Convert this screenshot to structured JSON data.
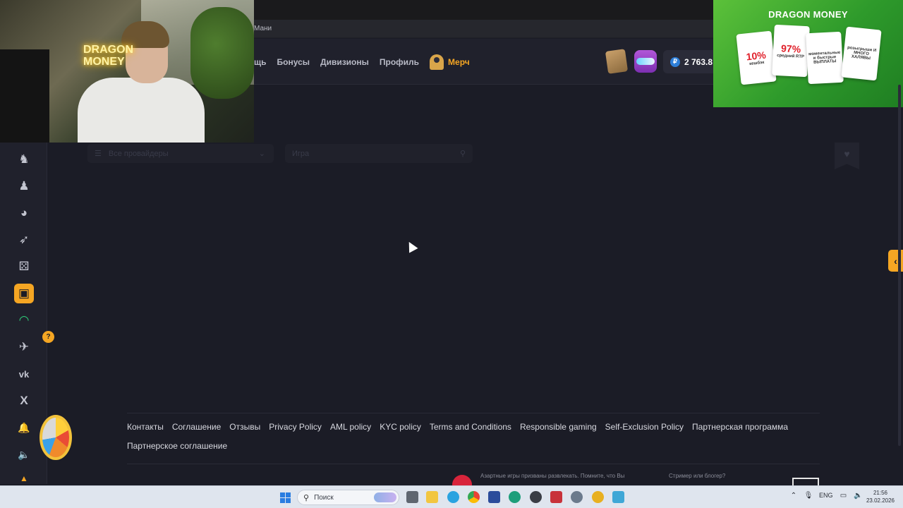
{
  "browser": {
    "tab_text": "Мани"
  },
  "header": {
    "nav": [
      {
        "label": "щь"
      },
      {
        "label": "Бонусы"
      },
      {
        "label": "Дивизионы"
      },
      {
        "label": "Профиль"
      }
    ],
    "merch_label": "Мерч",
    "balance": "2 763.8",
    "currency_symbol": "₽"
  },
  "webcam": {
    "neon_text_1": "DRAGON",
    "neon_text_2": "MONEY"
  },
  "ad": {
    "brand": "DRAGON MONEY",
    "cards": [
      {
        "big": "10%",
        "small": "кешбэк"
      },
      {
        "big": "97%",
        "small": "средний RTP"
      },
      {
        "big": "",
        "small": "моментальные и быстрые ВЫПЛАТЫ"
      },
      {
        "big": "",
        "small": "розыгрыши И МНОГО ХАЛЯВЫ"
      }
    ]
  },
  "sidebar": {
    "badge": "?",
    "items": [
      {
        "name": "dragon-icon",
        "glyph": "♞"
      },
      {
        "name": "user-icon",
        "glyph": "♟"
      },
      {
        "name": "joystick-icon",
        "glyph": "◕"
      },
      {
        "name": "rocket-icon",
        "glyph": "➶"
      },
      {
        "name": "dice-icon",
        "glyph": "⚄"
      },
      {
        "name": "slot-machine-icon",
        "glyph": "▣"
      },
      {
        "name": "gauge-icon",
        "glyph": "◠"
      },
      {
        "name": "telegram-icon",
        "glyph": "✈"
      },
      {
        "name": "vk-icon",
        "glyph": "vk"
      },
      {
        "name": "x-icon",
        "glyph": "X"
      },
      {
        "name": "bell-icon",
        "glyph": "🔔"
      },
      {
        "name": "speaker-icon",
        "glyph": "🔈"
      },
      {
        "name": "bottom-icon",
        "glyph": "▲"
      }
    ]
  },
  "filters": {
    "provider_placeholder": "Все провайдеры",
    "search_placeholder": "Игра"
  },
  "footer": {
    "links": [
      "Контакты",
      "Соглашение",
      "Отзывы",
      "Privacy Policy",
      "AML policy",
      "KYC policy",
      "Terms and Conditions",
      "Responsible gaming",
      "Self-Exclusion Policy",
      "Партнерская программа",
      "Партнерское соглашение"
    ],
    "note_1": "Азартные игры призваны развлекать. Помните, что Вы",
    "note_2": "Стример или блогер?"
  },
  "taskbar": {
    "search_label": "Поиск",
    "language": "ENG",
    "time": "21:56",
    "date": "23.02.2026"
  },
  "colors": {
    "accent": "#f5a623",
    "page_bg": "#1b1c26",
    "panel_bg": "#20212c"
  }
}
